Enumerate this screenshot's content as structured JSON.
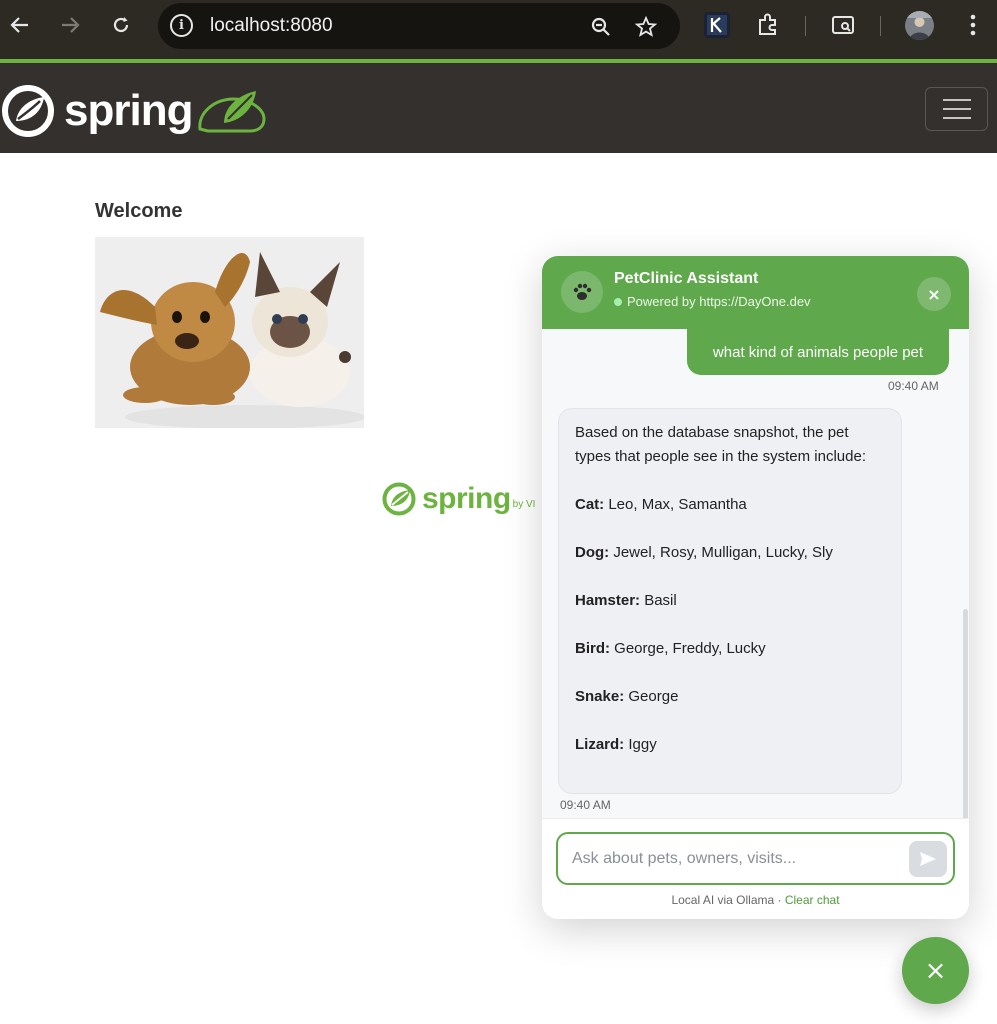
{
  "browser": {
    "url": "localhost:8080",
    "icons": [
      "back-arrow-icon",
      "forward-arrow-icon",
      "reload-icon",
      "site-info-icon",
      "zoom-icon",
      "star-icon",
      "extension-icon",
      "puzzle-icon",
      "tab-search-icon",
      "profile-avatar-icon",
      "kebab-menu-icon"
    ]
  },
  "navbar": {
    "brand": "spring"
  },
  "main": {
    "heading": "Welcome",
    "footer_brand": "spring",
    "footer_by": "by VI"
  },
  "chat": {
    "title": "PetClinic Assistant",
    "subtitle": "Powered by https://DayOne.dev",
    "close_label": "×",
    "messages": [
      {
        "role": "user",
        "text": "what kind of animals people pet",
        "time": "09:40 AM"
      },
      {
        "role": "assistant",
        "intro": "Based on the database snapshot, the pet types that people see in the system include:",
        "pets": [
          {
            "type": "Cat:",
            "names": "Leo, Max, Samantha"
          },
          {
            "type": "Dog:",
            "names": "Jewel, Rosy, Mulligan, Lucky, Sly"
          },
          {
            "type": "Hamster:",
            "names": "Basil"
          },
          {
            "type": "Bird:",
            "names": "George, Freddy, Lucky"
          },
          {
            "type": "Snake:",
            "names": "George"
          },
          {
            "type": "Lizard:",
            "names": "Iggy"
          }
        ],
        "time": "09:40 AM"
      }
    ],
    "input_placeholder": "Ask about pets, owners, visits...",
    "footnote_prefix": "Local AI via Ollama · ",
    "clear_label": "Clear chat"
  },
  "fab": {
    "label": "×"
  },
  "colors": {
    "accent": "#5fa84c",
    "navbar": "#34302d",
    "browser": "#2c2a22",
    "spring_green": "#6db33f"
  }
}
